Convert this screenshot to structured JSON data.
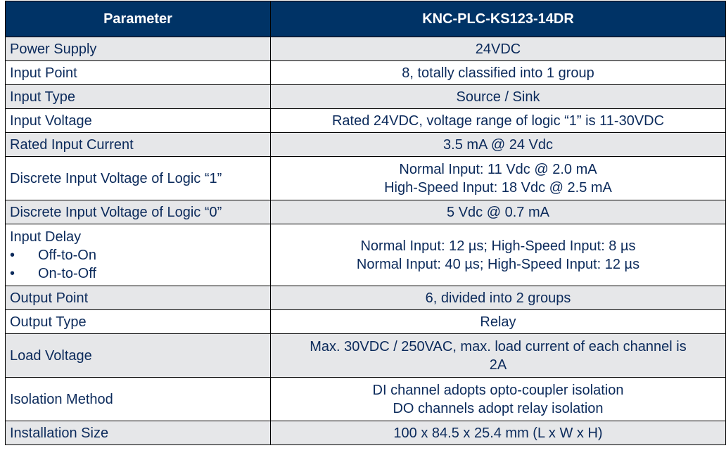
{
  "table": {
    "header": {
      "parameter_label": "Parameter",
      "model_label": "KNC-PLC-KS123-14DR"
    },
    "colors": {
      "header_bg": "#003366",
      "header_text": "#ffffff",
      "shaded_row_bg": "#e6e7e9",
      "text": "#0b2a5b"
    },
    "rows": [
      {
        "parameter": "Power Supply",
        "value": [
          "24VDC"
        ]
      },
      {
        "parameter": "Input Point",
        "value": [
          "8, totally classified into 1 group"
        ]
      },
      {
        "parameter": "Input Type",
        "value": [
          "Source / Sink"
        ]
      },
      {
        "parameter": "Input Voltage",
        "value": [
          "Rated 24VDC, voltage range of logic “1” is 11-30VDC"
        ]
      },
      {
        "parameter": "Rated Input Current",
        "value": [
          "3.5 mA @ 24 Vdc"
        ]
      },
      {
        "parameter": "Discrete Input Voltage of Logic “1”",
        "value": [
          "Normal Input: 11 Vdc @ 2.0 mA",
          "High-Speed Input: 18 Vdc @ 2.5 mA"
        ]
      },
      {
        "parameter": "Discrete Input Voltage of Logic “0”",
        "value": [
          "5 Vdc @ 0.7 mA"
        ]
      },
      {
        "parameter": "Input Delay",
        "sub_items": [
          "Off-to-On",
          "On-to-Off"
        ],
        "bullet": "•",
        "value": [
          "Normal Input: 12 µs; High-Speed Input: 8 µs",
          "Normal Input: 40 µs; High-Speed Input: 12 µs"
        ]
      },
      {
        "parameter": "Output Point",
        "value": [
          "6, divided into 2 groups"
        ]
      },
      {
        "parameter": "Output Type",
        "value": [
          "Relay"
        ]
      },
      {
        "parameter": "Load Voltage",
        "value": [
          "Max. 30VDC / 250VAC, max. load current of each channel is",
          "2A"
        ]
      },
      {
        "parameter": "Isolation Method",
        "value": [
          "DI channel adopts opto-coupler isolation",
          "DO channels adopt relay isolation"
        ]
      },
      {
        "parameter": "Installation Size",
        "value": [
          "100 x 84.5 x 25.4 mm (L x W x H)"
        ]
      }
    ]
  }
}
